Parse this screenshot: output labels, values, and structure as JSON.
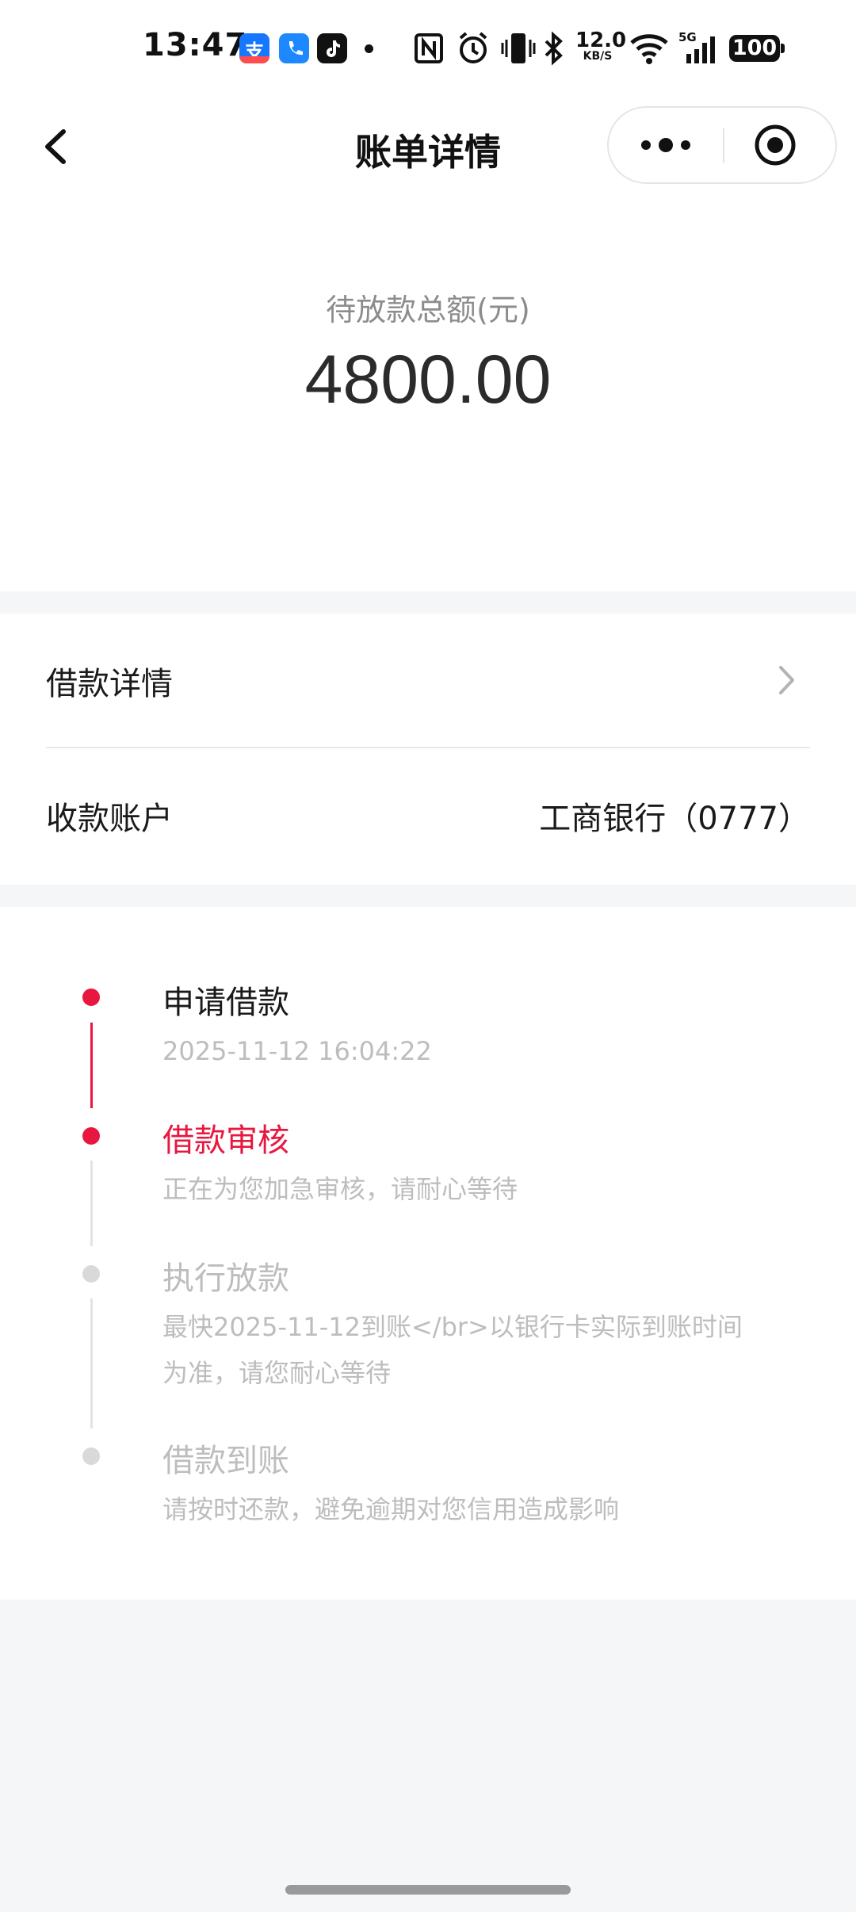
{
  "status_bar": {
    "time": "13:47",
    "net_speed_value": "12.0",
    "net_speed_unit": "KB/S",
    "battery": "100",
    "icons": [
      "alipay-icon",
      "phone-icon",
      "tiktok-icon",
      "nfc-icon",
      "alarm-icon",
      "vibrate-icon",
      "bluetooth-icon",
      "wifi-icon",
      "5g-signal-icon"
    ]
  },
  "nav": {
    "title": "账单详情",
    "icons": [
      "back-arrow-icon",
      "more-dots-icon",
      "target-close-icon"
    ]
  },
  "amount": {
    "label": "待放款总额(元)",
    "value": "4800.00"
  },
  "info": {
    "loan_detail_label": "借款详情",
    "account_label": "收款账户",
    "account_value": "工商银行（0777）"
  },
  "timeline": {
    "steps": [
      {
        "title": "申请借款",
        "desc": "2025-11-12 16:04:22",
        "state": "done"
      },
      {
        "title": "借款审核",
        "desc": "正在为您加急审核，请耐心等待",
        "state": "active"
      },
      {
        "title": "执行放款",
        "desc": "最快2025-11-12到账</br>以银行卡实际到账时间为准，请您耐心等待",
        "state": "pending"
      },
      {
        "title": "借款到账",
        "desc": "请按时还款，避免逾期对您信用造成影响",
        "state": "pending"
      }
    ]
  },
  "colors": {
    "accent": "#e8173f",
    "page_bg": "#f5f6f8",
    "muted_text": "#bdbdbd"
  }
}
